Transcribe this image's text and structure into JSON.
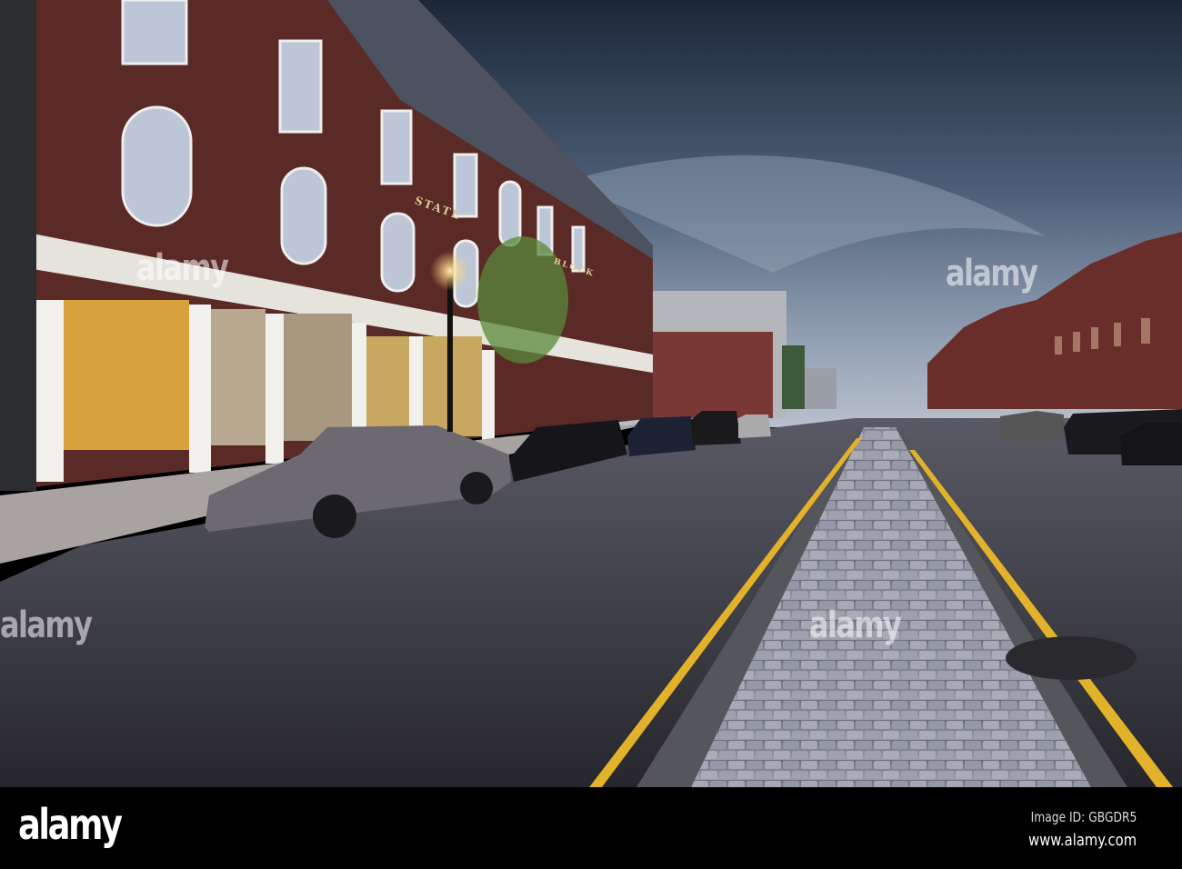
{
  "photo": {
    "signs": {
      "top": "STATE",
      "bottom": "BLOCK"
    },
    "watermark": "alamy"
  },
  "footer": {
    "logo": "alamy",
    "image_id": "Image ID: GBGDR5",
    "url": "www.alamy.com"
  },
  "colors": {
    "sky_dark": "#1f2a3c",
    "brick": "#5a2a26",
    "road": "#2f2f36",
    "yellow_line": "#e2b22a"
  }
}
